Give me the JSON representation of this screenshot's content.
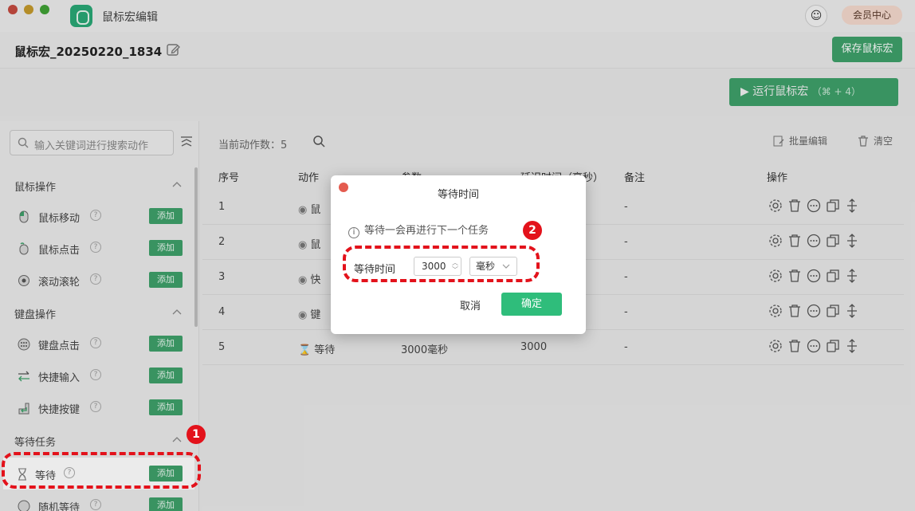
{
  "window": {
    "app_title": "鼠标宏编辑",
    "vip_label": "会员中心"
  },
  "header": {
    "macro_name": "鼠标宏_20250220_1834",
    "save_label": "保存鼠标宏"
  },
  "run": {
    "label": "运行鼠标宏",
    "shortcut": "（⌘ + 4）"
  },
  "sidebar": {
    "search_placeholder": "输入关键词进行搜索动作",
    "groups": [
      {
        "title": "鼠标操作",
        "items": [
          {
            "label": "鼠标移动",
            "add": "添加",
            "icon": "mouse-icon"
          },
          {
            "label": "鼠标点击",
            "add": "添加",
            "icon": "mouse-click-icon"
          },
          {
            "label": "滚动滚轮",
            "add": "添加",
            "icon": "scroll-icon"
          }
        ]
      },
      {
        "title": "键盘操作",
        "items": [
          {
            "label": "键盘点击",
            "add": "添加",
            "icon": "keyboard-icon"
          },
          {
            "label": "快捷输入",
            "add": "添加",
            "icon": "arrows-icon"
          },
          {
            "label": "快捷按键",
            "add": "添加",
            "icon": "enter-key-icon"
          }
        ]
      },
      {
        "title": "等待任务",
        "items": [
          {
            "label": "等待",
            "add": "添加",
            "icon": "hourglass-icon"
          },
          {
            "label": "随机等待",
            "add": "添加",
            "icon": "random-wait-icon"
          }
        ]
      }
    ]
  },
  "main": {
    "count_label": "当前动作数：5",
    "batch_edit": "批量编辑",
    "clear": "清空",
    "columns": [
      "序号",
      "动作",
      "参数",
      "延迟时间（毫秒）",
      "备注",
      "操作"
    ],
    "rows": [
      {
        "index": "1",
        "action": "鼠",
        "param": "",
        "delay": "",
        "note": "-"
      },
      {
        "index": "2",
        "action": "鼠",
        "param": "",
        "delay": "",
        "note": "-"
      },
      {
        "index": "3",
        "action": "快",
        "param": "",
        "delay": "",
        "note": "-"
      },
      {
        "index": "4",
        "action": "键",
        "param": "",
        "delay": "",
        "note": "-"
      },
      {
        "index": "5",
        "action": "等待",
        "param": "3000毫秒",
        "delay": "3000",
        "note": "-"
      }
    ]
  },
  "modal": {
    "title": "等待时间",
    "tip": "等待一会再进行下一个任务",
    "field_label": "等待时间",
    "value": "3000",
    "unit": "毫秒",
    "cancel": "取消",
    "ok": "确定"
  },
  "annotations": {
    "one": "1",
    "two": "2"
  },
  "colors": {
    "accent": "#3ea06a",
    "annotation": "#e3121b",
    "ok": "#2fbd7b"
  }
}
